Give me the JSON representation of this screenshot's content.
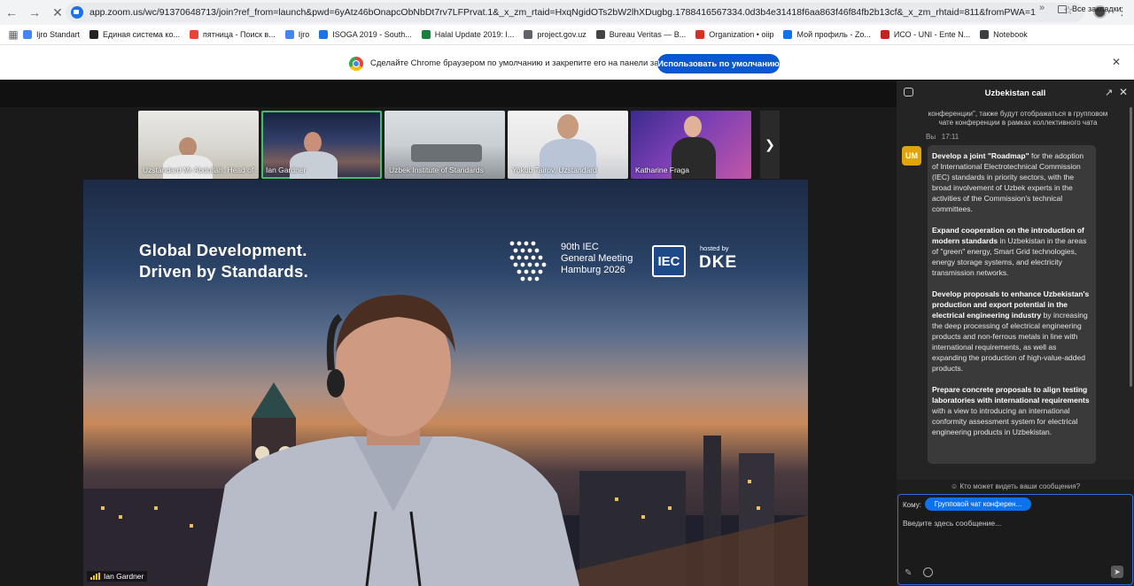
{
  "browser": {
    "url": "app.zoom.us/wc/91370648713/join?ref_from=launch&pwd=6yAtz46bOnapcObNbDt7rv7LFPrvat.1&_x_zm_rtaid=HxqNgidOTs2bW2lhXDugbg.1788416567334.0d3b4e31418f6aa863f46f84fb2b13cf&_x_zm_rhtaid=811&fromPWA=1",
    "bookmarks": [
      {
        "label": "Ijro Standart",
        "color": "#4285f4"
      },
      {
        "label": "Единая система ко...",
        "color": "#222222"
      },
      {
        "label": "пятница - Поиск в...",
        "color": "#ea4335"
      },
      {
        "label": "Ijro",
        "color": "#4285f4"
      },
      {
        "label": "ISOGA 2019 - South...",
        "color": "#1a73e8"
      },
      {
        "label": "Halal Update 2019: I...",
        "color": "#188038"
      },
      {
        "label": "project.gov.uz",
        "color": "#5f6368"
      },
      {
        "label": "Bureau Veritas — B...",
        "color": "#444444"
      },
      {
        "label": "Organization • oiip",
        "color": "#d93025"
      },
      {
        "label": "Мой профиль - Zo...",
        "color": "#0e72ed"
      },
      {
        "label": "ИСО - UNI - Ente N...",
        "color": "#c5221f"
      },
      {
        "label": "Notebook",
        "color": "#3c4043"
      }
    ],
    "bookmarks_more": "»",
    "all_bookmarks": "Все закладки",
    "infobar": {
      "text": "Сделайте Chrome браузером по умолчанию и закрепите его на панели задач.",
      "button": "Использовать по умолчанию"
    }
  },
  "meeting": {
    "thumbnails": [
      {
        "name": "Uzstandard Mr Abdullah, Head of ...",
        "active": false
      },
      {
        "name": "Ian Gardner",
        "active": true
      },
      {
        "name": "Uzbek Institute of Standards",
        "active": false
      },
      {
        "name": "Yokub Tairov, Uzstandard",
        "active": false
      },
      {
        "name": "Katharine Fraga",
        "active": false
      }
    ],
    "main": {
      "speaker": "Ian Gardner",
      "title_line1": "Global Development.",
      "title_line2": "Driven by Standards.",
      "event_line1": "90th IEC",
      "event_line2": "General Meeting",
      "event_line3": "Hamburg 2026",
      "iec_logo": "IEC",
      "hosted_by": "hosted by",
      "host": "DKE"
    }
  },
  "chat": {
    "title": "Uzbekistan call",
    "previous_message": "конференции\", также будут отображаться в групповом чате конференции в рамках коллективного чата",
    "sender": "Вы",
    "time": "17:11",
    "avatar": "UM",
    "paragraphs": [
      {
        "bold": "Develop a joint \"Roadmap\"",
        "rest": " for the adoption of International Electrotechnical Commission (IEC) standards in priority sectors, with the broad involvement of Uzbek experts in the activities of the Commission's technical committees."
      },
      {
        "bold": "Expand cooperation on the introduction of modern standards",
        "rest": " in Uzbekistan in the areas of \"green\" energy, Smart Grid technologies, energy storage systems, and electricity transmission networks."
      },
      {
        "bold": "Develop proposals to enhance Uzbekistan's production and export potential in the electrical engineering industry",
        "rest": " by increasing the deep processing of electrical engineering products and non-ferrous metals in line with international requirements, as well as expanding the production of high-value-added products."
      },
      {
        "bold": "Prepare concrete proposals to align testing laboratories with international requirements",
        "rest": " with a view to introducing an international conformity assessment system for electrical engineering products in Uzbekistan."
      }
    ],
    "who_can_see": "Кто может видеть ваши сообщения?",
    "to_label": "Кому:",
    "recipient": "Групповой чат конферен...",
    "input_placeholder": "Введите здесь сообщение..."
  }
}
